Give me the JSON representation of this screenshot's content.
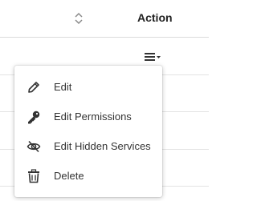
{
  "table": {
    "action_header": "Action",
    "sort_icon": "sort-updown-icon",
    "row_menu_icon": "hamburger-dropdown-icon"
  },
  "menu": {
    "items": [
      {
        "label": "Edit",
        "icon": "pencil-icon"
      },
      {
        "label": "Edit Permissions",
        "icon": "key-icon"
      },
      {
        "label": "Edit Hidden Services",
        "icon": "eye-slash-icon"
      },
      {
        "label": "Delete",
        "icon": "trash-icon"
      }
    ]
  },
  "colors": {
    "text": "#333333",
    "border": "#dcdcdc",
    "icon": "#333333"
  }
}
